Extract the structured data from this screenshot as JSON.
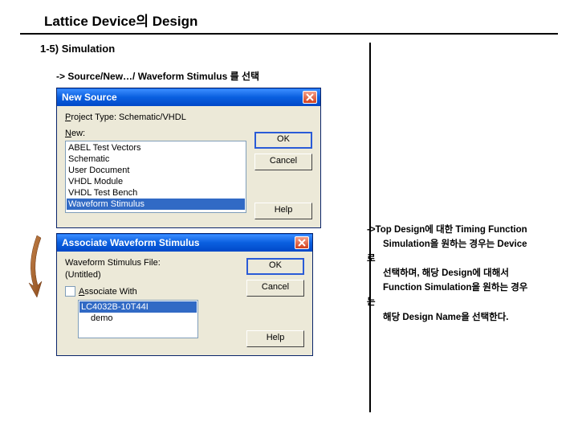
{
  "page": {
    "title": "Lattice Device의 Design",
    "section": "1-5) Simulation",
    "instruction": "-> Source/New…/ Waveform Stimulus 를 선택"
  },
  "dialog1": {
    "title": "New Source",
    "projectTypeLabel": "Project Type: Schematic/VHDL",
    "newLabel": "New:",
    "items": [
      "ABEL Test Vectors",
      "Schematic",
      "User Document",
      "VHDL Module",
      "VHDL Test Bench",
      "Waveform Stimulus"
    ],
    "ok": "OK",
    "cancel": "Cancel",
    "help": "Help"
  },
  "dialog2": {
    "title": "Associate Waveform Stimulus",
    "stimLabel": "Waveform Stimulus File:",
    "untitled": "(Untitled)",
    "assocLabel": "Associate With",
    "items": [
      "LC4032B-10T44I",
      "demo"
    ],
    "ok": "OK",
    "cancel": "Cancel",
    "help": "Help"
  },
  "rightText": {
    "l1": "->Top Design에 대한 Timing Function",
    "l2": "Simulation을 원하는 경우는 Device",
    "l3": "로",
    "l4": "선택하며, 해당 Design에 대해서",
    "l5": "Function Simulation을 원하는 경우",
    "l6": "는",
    "l7": "해당 Design Name을 선택한다."
  }
}
